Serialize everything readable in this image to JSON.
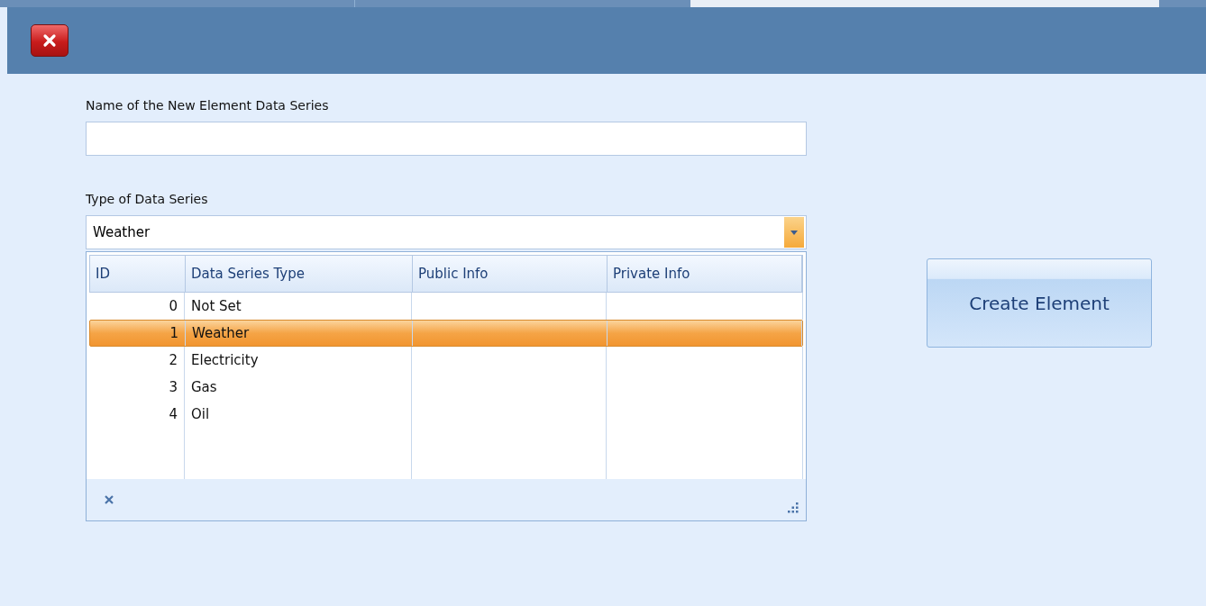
{
  "name_field": {
    "label": "Name of the New Element Data Series"
  },
  "type_field": {
    "label": "Type of Data Series",
    "value": "Weather"
  },
  "grid": {
    "columns": [
      "ID",
      "Data Series Type",
      "Public Info",
      "Private Info"
    ],
    "rows": [
      {
        "id": "0",
        "type": "Not Set",
        "selected": false
      },
      {
        "id": "1",
        "type": "Weather",
        "selected": true
      },
      {
        "id": "2",
        "type": "Electricity",
        "selected": false
      },
      {
        "id": "3",
        "type": "Gas",
        "selected": false
      },
      {
        "id": "4",
        "type": "Oil",
        "selected": false
      }
    ]
  },
  "button": "Create Element"
}
